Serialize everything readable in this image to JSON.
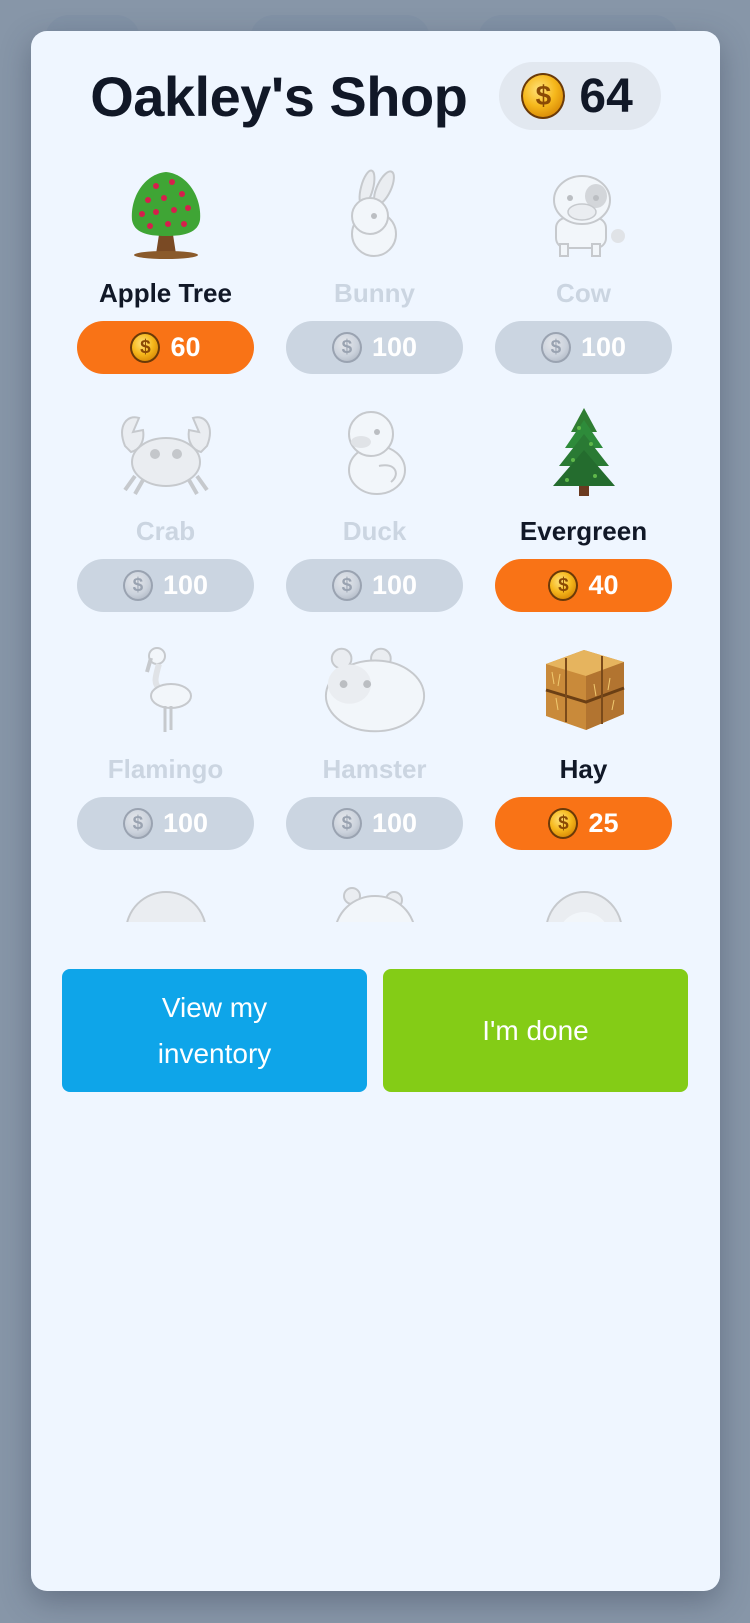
{
  "shop": {
    "title": "Oakley's Shop",
    "balance": "64",
    "currency_icon": "coin-icon"
  },
  "items": [
    {
      "name": "Apple Tree",
      "price": "60",
      "status": "available",
      "icon": "apple-tree"
    },
    {
      "name": "Bunny",
      "price": "100",
      "status": "locked",
      "icon": "bunny"
    },
    {
      "name": "Cow",
      "price": "100",
      "status": "locked",
      "icon": "cow"
    },
    {
      "name": "Crab",
      "price": "100",
      "status": "locked",
      "icon": "crab"
    },
    {
      "name": "Duck",
      "price": "100",
      "status": "locked",
      "icon": "duck"
    },
    {
      "name": "Evergreen",
      "price": "40",
      "status": "available",
      "icon": "evergreen"
    },
    {
      "name": "Flamingo",
      "price": "100",
      "status": "locked",
      "icon": "flamingo"
    },
    {
      "name": "Hamster",
      "price": "100",
      "status": "locked",
      "icon": "hamster"
    },
    {
      "name": "Hay",
      "price": "25",
      "status": "available",
      "icon": "hay-bale"
    }
  ],
  "partial_items": [
    {
      "icon": "hedgehog"
    },
    {
      "icon": "animal"
    },
    {
      "icon": "lion"
    }
  ],
  "actions": {
    "inventory_label": "View my inventory",
    "done_label": "I'm done"
  },
  "colors": {
    "available_price": "#f97316",
    "locked_price": "#cbd5e1",
    "inventory_button": "#0ea5e9",
    "done_button": "#84cc16"
  }
}
